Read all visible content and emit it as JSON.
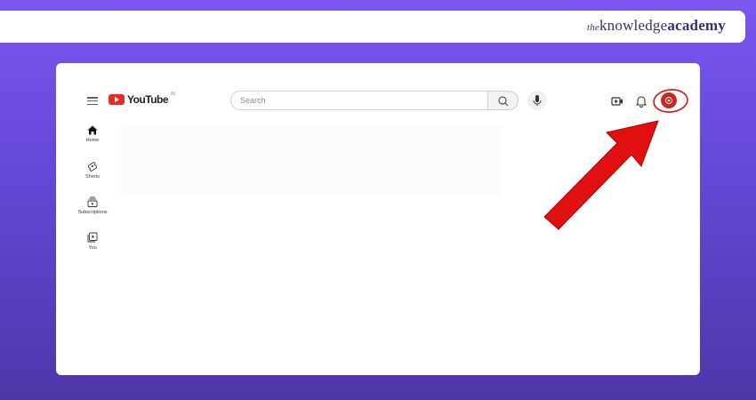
{
  "brand": {
    "prefix": "the",
    "word1": "knowledge",
    "word2": "academy"
  },
  "youtube": {
    "logo_text": "YouTube",
    "country_code": "IN",
    "search": {
      "placeholder": "Search"
    },
    "sidebar": {
      "items": [
        {
          "label": "Home",
          "icon": "home-icon"
        },
        {
          "label": "Shorts",
          "icon": "shorts-icon"
        },
        {
          "label": "Subscriptions",
          "icon": "subscriptions-icon"
        },
        {
          "label": "You",
          "icon": "you-icon"
        }
      ]
    },
    "header_icons": [
      "menu-icon",
      "search-icon",
      "mic-icon",
      "create-icon",
      "bell-icon",
      "avatar"
    ]
  },
  "colors": {
    "background_top": "#7a57f0",
    "background_bottom": "#4e36a8",
    "youtube_red": "#e52d27",
    "annotation_red": "#e01010",
    "brand_text": "#3b2e73"
  }
}
